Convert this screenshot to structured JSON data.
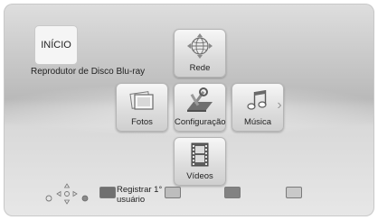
{
  "home": {
    "title": "INÍCIO",
    "subtitle": "Reprodutor de Disco Blu-ray"
  },
  "menu": {
    "network": {
      "label": "Rede",
      "icon": "globe-icon"
    },
    "photos": {
      "label": "Fotos",
      "icon": "photos-icon"
    },
    "settings": {
      "label": "Configuração",
      "icon": "settings-tools-icon"
    },
    "music": {
      "label": "Música",
      "icon": "music-notes-icon"
    },
    "videos": {
      "label": "Vídeos",
      "icon": "film-strip-icon"
    },
    "prev_arrow": "‹",
    "next_arrow": "›"
  },
  "footer": {
    "color_button_1_label": "Registrar 1° usuário",
    "nav_icon": "dpad-navigation-icon",
    "colors": [
      "#707070",
      "#bdbdbd",
      "#828282",
      "#c9c9c9"
    ]
  }
}
